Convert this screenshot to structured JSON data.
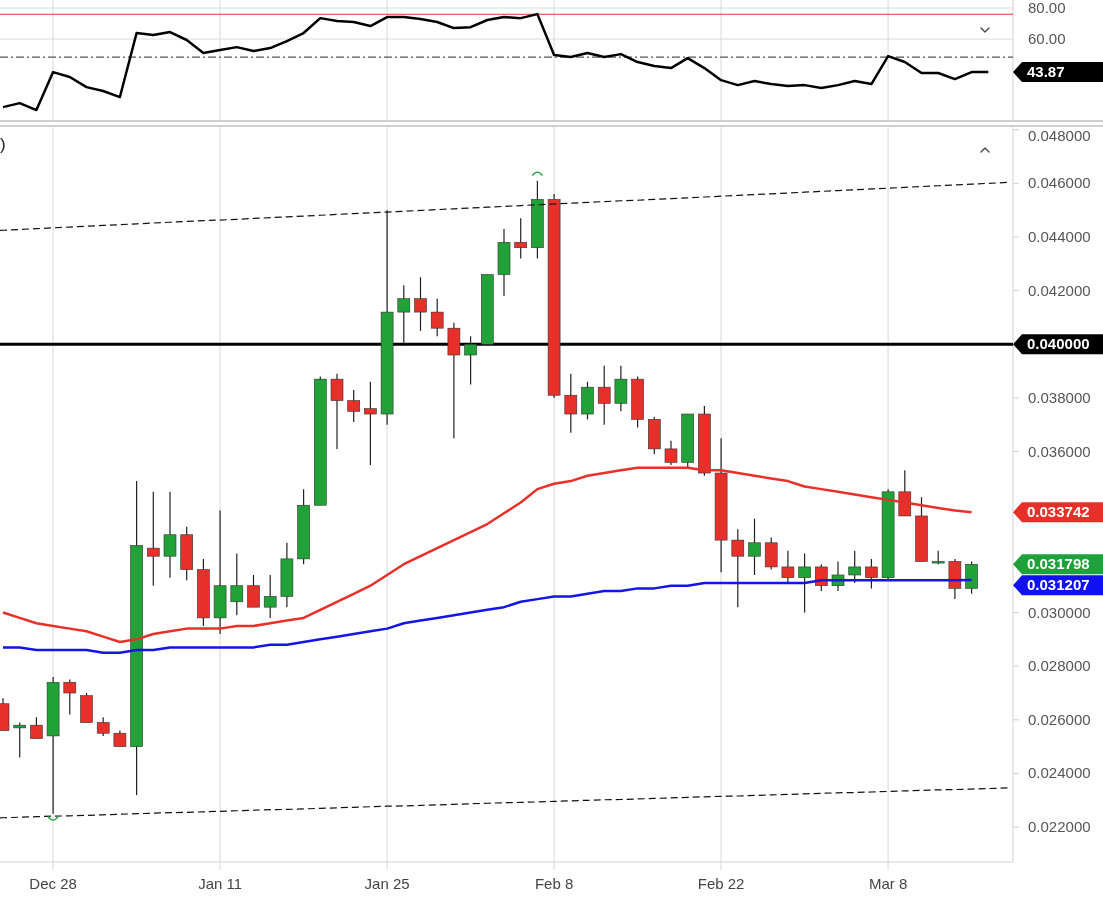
{
  "rsi_panel": {
    "chart_data": {
      "type": "line",
      "ylim": [
        7.8,
        85.2
      ],
      "grid": true,
      "yticks": [
        {
          "value": 80,
          "label": "80.00"
        },
        {
          "value": 60,
          "label": "60.00"
        }
      ],
      "series": [
        {
          "color": "#000000",
          "values": [
            16.1,
            18.7,
            14.2,
            38.7,
            35.5,
            29.0,
            26.5,
            22.6,
            63.9,
            62.6,
            64.5,
            59.4,
            51.0,
            52.9,
            54.8,
            52.3,
            54.2,
            58.7,
            63.9,
            73.5,
            71.6,
            71.0,
            68.4,
            74.2,
            74.2,
            72.9,
            71.0,
            67.1,
            67.7,
            72.3,
            74.2,
            73.5,
            76.1,
            49.7,
            48.4,
            51.0,
            48.4,
            50.3,
            45.2,
            42.6,
            41.3,
            47.7,
            41.3,
            33.5,
            30.3,
            32.9,
            31.0,
            29.7,
            30.3,
            28.4,
            30.3,
            32.9,
            31.0,
            49.0,
            45.2,
            38.1,
            38.1,
            34.2,
            38.7,
            38.7
          ]
        }
      ],
      "ref_lines": [
        {
          "axis": "y",
          "value": 76,
          "color": "#e8302a"
        },
        {
          "axis": "y",
          "value": 48.4,
          "color": "#555555"
        }
      ]
    },
    "tags": [
      {
        "label": "43.87",
        "color": "#000000",
        "kind": "last"
      }
    ]
  },
  "price_panel": {
    "legend": ")",
    "chart_data": {
      "type": "candlestick",
      "ylim": [
        0.0207,
        0.0481
      ],
      "grid": true,
      "categories": [
        null,
        null,
        null,
        "Dec 28",
        null,
        null,
        null,
        null,
        null,
        null,
        null,
        null,
        null,
        "Jan 11",
        null,
        null,
        null,
        null,
        null,
        null,
        null,
        null,
        null,
        "Jan 25",
        null,
        null,
        null,
        null,
        null,
        null,
        null,
        null,
        null,
        "Feb 8",
        null,
        null,
        null,
        null,
        null,
        null,
        null,
        null,
        null,
        "Feb 22",
        null,
        null,
        null,
        null,
        null,
        null,
        null,
        null,
        null,
        "Mar 8",
        null,
        null,
        null,
        null,
        null
      ],
      "yticks": [
        {
          "value": 0.048,
          "label": "0.048000"
        },
        {
          "value": 0.046,
          "label": "0.046000"
        },
        {
          "value": 0.044,
          "label": "0.044000"
        },
        {
          "value": 0.042,
          "label": "0.042000"
        },
        {
          "value": 0.038,
          "label": "0.038000"
        },
        {
          "value": 0.036,
          "label": "0.036000"
        },
        {
          "value": 0.03,
          "label": "0.030000"
        },
        {
          "value": 0.028,
          "label": "0.028000"
        },
        {
          "value": 0.026,
          "label": "0.026000"
        },
        {
          "value": 0.024,
          "label": "0.024000"
        },
        {
          "value": 0.022,
          "label": "0.022000"
        }
      ],
      "ohlc": [
        [
          0.0266,
          0.0268,
          0.0256,
          0.0256
        ],
        [
          0.0257,
          0.0259,
          0.0246,
          0.0258
        ],
        [
          0.0258,
          0.0261,
          0.0253,
          0.0253
        ],
        [
          0.0254,
          0.0276,
          0.0225,
          0.0274
        ],
        [
          0.0274,
          0.0275,
          0.0262,
          0.027
        ],
        [
          0.0269,
          0.027,
          0.0259,
          0.0259
        ],
        [
          0.0259,
          0.0261,
          0.0254,
          0.0255
        ],
        [
          0.0255,
          0.0256,
          0.025,
          0.025
        ],
        [
          0.025,
          0.0349,
          0.0232,
          0.0325
        ],
        [
          0.0324,
          0.0345,
          0.031,
          0.0321
        ],
        [
          0.0321,
          0.0345,
          0.0313,
          0.0329
        ],
        [
          0.0329,
          0.0332,
          0.0312,
          0.0316
        ],
        [
          0.0316,
          0.032,
          0.0295,
          0.0298
        ],
        [
          0.0298,
          0.0338,
          0.0292,
          0.031
        ],
        [
          0.0304,
          0.0322,
          0.0299,
          0.031
        ],
        [
          0.031,
          0.0314,
          0.0302,
          0.0302
        ],
        [
          0.0302,
          0.0314,
          0.0298,
          0.0306
        ],
        [
          0.0306,
          0.0326,
          0.0302,
          0.032
        ],
        [
          0.032,
          0.0346,
          0.0318,
          0.034
        ],
        [
          0.034,
          0.0388,
          0.034,
          0.0387
        ],
        [
          0.0387,
          0.0389,
          0.0361,
          0.0379
        ],
        [
          0.0379,
          0.0383,
          0.0371,
          0.0375
        ],
        [
          0.0376,
          0.0386,
          0.0355,
          0.0374
        ],
        [
          0.0374,
          0.045,
          0.037,
          0.0412
        ],
        [
          0.0412,
          0.0422,
          0.04,
          0.0417
        ],
        [
          0.0417,
          0.0425,
          0.0405,
          0.0412
        ],
        [
          0.0412,
          0.0417,
          0.0403,
          0.0406
        ],
        [
          0.0406,
          0.0408,
          0.0365,
          0.0396
        ],
        [
          0.0396,
          0.0403,
          0.0385,
          0.04
        ],
        [
          0.04,
          0.0426,
          0.04,
          0.0426
        ],
        [
          0.0426,
          0.0443,
          0.0418,
          0.0438
        ],
        [
          0.0438,
          0.0447,
          0.0432,
          0.0436
        ],
        [
          0.0436,
          0.0461,
          0.0432,
          0.0454
        ],
        [
          0.0454,
          0.0456,
          0.038,
          0.0381
        ],
        [
          0.0381,
          0.0389,
          0.0367,
          0.0374
        ],
        [
          0.0374,
          0.0386,
          0.0372,
          0.0384
        ],
        [
          0.0384,
          0.0392,
          0.037,
          0.0378
        ],
        [
          0.0378,
          0.0392,
          0.0375,
          0.0387
        ],
        [
          0.0387,
          0.0388,
          0.0369,
          0.0372
        ],
        [
          0.0372,
          0.0373,
          0.0359,
          0.0361
        ],
        [
          0.0361,
          0.0364,
          0.0355,
          0.0356
        ],
        [
          0.0356,
          0.0374,
          0.0354,
          0.0374
        ],
        [
          0.0374,
          0.0377,
          0.0351,
          0.0352
        ],
        [
          0.0352,
          0.0365,
          0.0315,
          0.0327
        ],
        [
          0.0327,
          0.0331,
          0.0302,
          0.0321
        ],
        [
          0.0321,
          0.0335,
          0.0314,
          0.0326
        ],
        [
          0.0326,
          0.0328,
          0.0316,
          0.0317
        ],
        [
          0.0317,
          0.0323,
          0.0311,
          0.0313
        ],
        [
          0.0313,
          0.0322,
          0.03,
          0.0317
        ],
        [
          0.0317,
          0.0318,
          0.0308,
          0.031
        ],
        [
          0.031,
          0.0319,
          0.0308,
          0.0314
        ],
        [
          0.0314,
          0.0323,
          0.0311,
          0.0317
        ],
        [
          0.0317,
          0.032,
          0.0309,
          0.0313
        ],
        [
          0.0313,
          0.0346,
          0.0312,
          0.0345
        ],
        [
          0.0345,
          0.0353,
          0.0336,
          0.0336
        ],
        [
          0.0336,
          0.0343,
          0.0319,
          0.0319
        ],
        [
          0.0319,
          0.0323,
          0.0318,
          0.0319
        ],
        [
          0.0319,
          0.032,
          0.0305,
          0.0309
        ],
        [
          0.0309,
          0.0319,
          0.0307,
          0.0318
        ]
      ],
      "series": [
        {
          "type": "line",
          "color": "#e8302a",
          "values": [
            0.03,
            0.0298,
            0.0296,
            0.0295,
            0.0294,
            0.0293,
            0.0291,
            0.0289,
            0.029,
            0.0292,
            0.0293,
            0.0294,
            0.0294,
            0.0294,
            0.0295,
            0.0295,
            0.0296,
            0.0297,
            0.0298,
            0.0301,
            0.0304,
            0.0307,
            0.031,
            0.0314,
            0.0318,
            0.0321,
            0.0324,
            0.0327,
            0.033,
            0.0333,
            0.0337,
            0.0341,
            0.0346,
            0.0348,
            0.0349,
            0.0351,
            0.0352,
            0.0353,
            0.0354,
            0.0354,
            0.0354,
            0.0354,
            0.0353,
            0.0353,
            0.0352,
            0.0351,
            0.035,
            0.0349,
            0.0347,
            0.0346,
            0.0345,
            0.0344,
            0.0343,
            0.0342,
            0.0341,
            0.034,
            0.0339,
            0.0338,
            0.03374
          ]
        },
        {
          "type": "line",
          "color": "#1414e6",
          "values": [
            0.0287,
            0.0287,
            0.0286,
            0.0286,
            0.0286,
            0.0286,
            0.0285,
            0.0285,
            0.0286,
            0.0286,
            0.0287,
            0.0287,
            0.0287,
            0.0287,
            0.0287,
            0.0287,
            0.0288,
            0.0288,
            0.0289,
            0.029,
            0.0291,
            0.0292,
            0.0293,
            0.0294,
            0.0296,
            0.0297,
            0.0298,
            0.0299,
            0.03,
            0.0301,
            0.0302,
            0.0304,
            0.0305,
            0.0306,
            0.0306,
            0.0307,
            0.0308,
            0.0308,
            0.0309,
            0.0309,
            0.031,
            0.031,
            0.0311,
            0.0311,
            0.0311,
            0.0311,
            0.0311,
            0.0311,
            0.0311,
            0.0312,
            0.0312,
            0.0312,
            0.0312,
            0.0312,
            0.0312,
            0.0312,
            0.0312,
            0.0312,
            0.03121
          ]
        },
        {
          "type": "line",
          "line_style": "dashed",
          "color": "#111111",
          "values": [
            0.04425,
            0.04428,
            0.04431,
            0.04434,
            0.04437,
            0.0444,
            0.04443,
            0.04446,
            0.04449,
            0.04452,
            0.04455,
            0.04458,
            0.04461,
            0.04463,
            0.04466,
            0.04469,
            0.04472,
            0.04475,
            0.04478,
            0.04481,
            0.04484,
            0.04487,
            0.0449,
            0.04493,
            0.04496,
            0.04499,
            0.04502,
            0.04505,
            0.04508,
            0.04511,
            0.04514,
            0.04517,
            0.0452,
            0.04523,
            0.04526,
            0.04529,
            0.04532,
            0.04535,
            0.04537,
            0.0454,
            0.04543,
            0.04546,
            0.04549,
            0.04552,
            0.04555,
            0.04558,
            0.04561,
            0.04564,
            0.04567,
            0.0457,
            0.04573,
            0.04576,
            0.04579,
            0.04582,
            0.04585,
            0.04588,
            0.04591,
            0.04594,
            0.04597
          ]
        },
        {
          "type": "line",
          "line_style": "dashed",
          "color": "#111111",
          "values": [
            0.02235,
            0.02237,
            0.02239,
            0.02241,
            0.02242,
            0.02244,
            0.02246,
            0.02248,
            0.0225,
            0.02252,
            0.02254,
            0.02255,
            0.02257,
            0.02259,
            0.02261,
            0.02263,
            0.02265,
            0.02266,
            0.02268,
            0.0227,
            0.02272,
            0.02274,
            0.02276,
            0.02278,
            0.02279,
            0.02281,
            0.02283,
            0.02285,
            0.02287,
            0.02289,
            0.02291,
            0.02292,
            0.02294,
            0.02296,
            0.02298,
            0.023,
            0.02302,
            0.02303,
            0.02305,
            0.02307,
            0.02309,
            0.02311,
            0.02313,
            0.02315,
            0.02316,
            0.02318,
            0.0232,
            0.02322,
            0.02324,
            0.02326,
            0.02328,
            0.02329,
            0.02331,
            0.02333,
            0.02335,
            0.02337,
            0.02339,
            0.0234,
            0.02342
          ]
        }
      ],
      "ref_lines": [
        {
          "axis": "y",
          "value": 0.04,
          "color": "#000000"
        }
      ]
    },
    "tags": [
      {
        "label": "0.040000",
        "color": "#000000",
        "kind": "ref_line"
      },
      {
        "label": "0.033742",
        "color": "#e8302a",
        "kind": "ma_fast"
      },
      {
        "label": "0.031798",
        "color": "#1ea03a",
        "kind": "close"
      },
      {
        "label": "0.031207",
        "color": "#1010f0",
        "kind": "ma_slow"
      }
    ]
  }
}
